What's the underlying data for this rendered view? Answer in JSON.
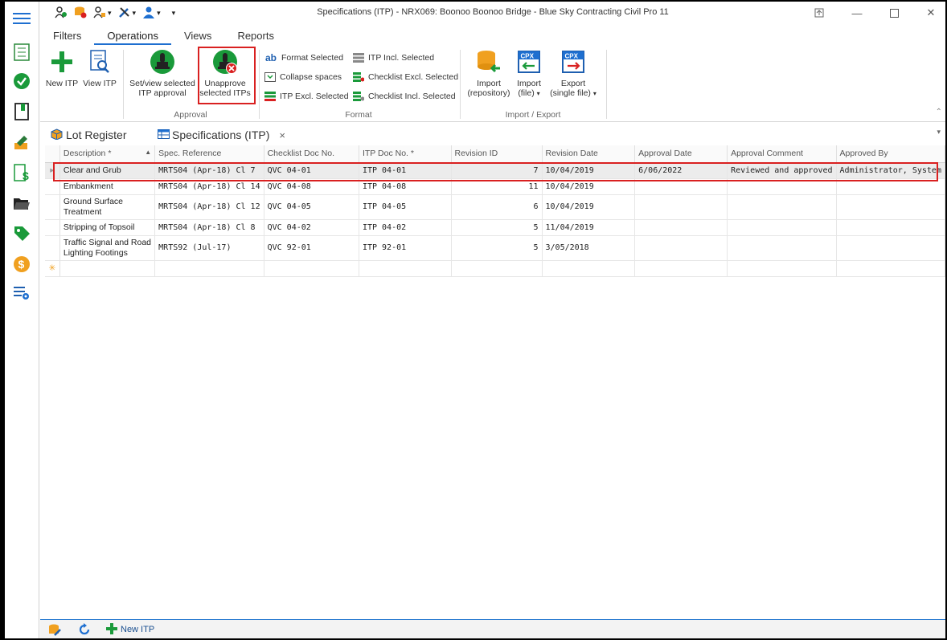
{
  "window": {
    "title": "Specifications (ITP) - NRX069: Boonoo Boonoo Bridge - Blue Sky Contracting Civil Pro 11"
  },
  "nav_icons": [
    "menu-icon",
    "checklist-icon",
    "check-circle-icon",
    "bookmark-book-icon",
    "pencil-icon",
    "invoice-dollar-icon",
    "folder-open-icon",
    "tag-icon",
    "dollar-coin-icon",
    "settings-list-icon"
  ],
  "ribbon_tabs": [
    "Filters",
    "Operations",
    "Views",
    "Reports"
  ],
  "ribbon": {
    "new_itp": "New ITP",
    "view_itp": "View ITP",
    "set_view_approval_l1": "Set/view selected",
    "set_view_approval_l2": "ITP approval",
    "unapprove_l1": "Unapprove",
    "unapprove_l2": "selected ITPs",
    "approval_group": "Approval",
    "format_selected": "Format Selected",
    "collapse_spaces": "Collapse spaces",
    "itp_excl_selected": "ITP Excl. Selected",
    "itp_incl_selected": "ITP Incl. Selected",
    "checklist_excl_selected": "Checklist Excl. Selected",
    "checklist_incl_selected": "Checklist Incl. Selected",
    "format_group": "Format",
    "import_repo_l1": "Import",
    "import_repo_l2": "(repository)",
    "import_file_l1": "Import",
    "import_file_l2": "(file)",
    "export_l1": "Export",
    "export_l2": "(single file)",
    "import_export_group": "Import / Export",
    "cpx": "CPX",
    "ab": "ab"
  },
  "doc_tabs": {
    "lot_register": "Lot Register",
    "specifications": "Specifications (ITP)",
    "close": "×"
  },
  "grid": {
    "columns": [
      "Description *",
      "Spec. Reference",
      "Checklist Doc No.",
      "ITP Doc No. *",
      "Revision ID",
      "Revision Date",
      "Approval Date",
      "Approval Comment",
      "Approved By"
    ],
    "rows": [
      {
        "description": "Clear and Grub",
        "spec_ref": "MRTS04 (Apr-18) Cl 7",
        "checklist_doc": "QVC 04-01",
        "itp_doc": "ITP 04-01",
        "revision_id": "7",
        "revision_date": "10/04/2019",
        "approval_date": "6/06/2022",
        "approval_comment": "Reviewed and approved",
        "approved_by": "Administrator, System"
      },
      {
        "description": "Embankment",
        "spec_ref": "MRTS04 (Apr-18) Cl 14",
        "checklist_doc": "QVC 04-08",
        "itp_doc": "ITP 04-08",
        "revision_id": "11",
        "revision_date": "10/04/2019",
        "approval_date": "",
        "approval_comment": "",
        "approved_by": ""
      },
      {
        "description": "Ground Surface Treatment",
        "spec_ref": "MRTS04 (Apr-18) Cl 12",
        "checklist_doc": "QVC 04-05",
        "itp_doc": "ITP 04-05",
        "revision_id": "6",
        "revision_date": "10/04/2019",
        "approval_date": "",
        "approval_comment": "",
        "approved_by": ""
      },
      {
        "description": "Stripping of Topsoil",
        "spec_ref": "MRTS04 (Apr-18) Cl 8",
        "checklist_doc": "QVC 04-02",
        "itp_doc": "ITP 04-02",
        "revision_id": "5",
        "revision_date": "11/04/2019",
        "approval_date": "",
        "approval_comment": "",
        "approved_by": ""
      },
      {
        "description": "Traffic Signal and Road Lighting Footings",
        "spec_ref": "MRTS92 (Jul-17)",
        "checklist_doc": "QVC 92-01",
        "itp_doc": "ITP 92-01",
        "revision_id": "5",
        "revision_date": "3/05/2018",
        "approval_date": "",
        "approval_comment": "",
        "approved_by": ""
      }
    ],
    "new_row_marker": "✳"
  },
  "statusbar": {
    "new_itp": "New ITP"
  },
  "colors": {
    "accent": "#1e6fd0",
    "highlight": "#d92020",
    "green": "#1a9a3a"
  }
}
